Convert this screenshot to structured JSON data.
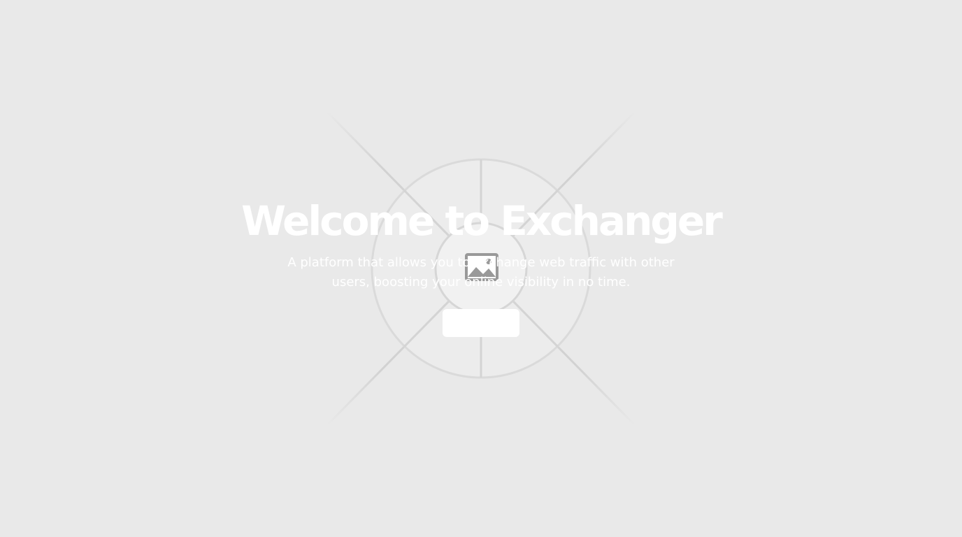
{
  "hero": {
    "title": "Welcome to Exchanger",
    "subtitle": "A platform that allows you to exchange web traffic with other users, boosting your online visibility in no time.",
    "button_label": "",
    "image_icon": "image-placeholder-icon"
  },
  "colors": {
    "background": "#e9e9e9",
    "text": "#ffffff",
    "button": "#ffffff",
    "placeholder_stroke": "#cfcfcf"
  }
}
